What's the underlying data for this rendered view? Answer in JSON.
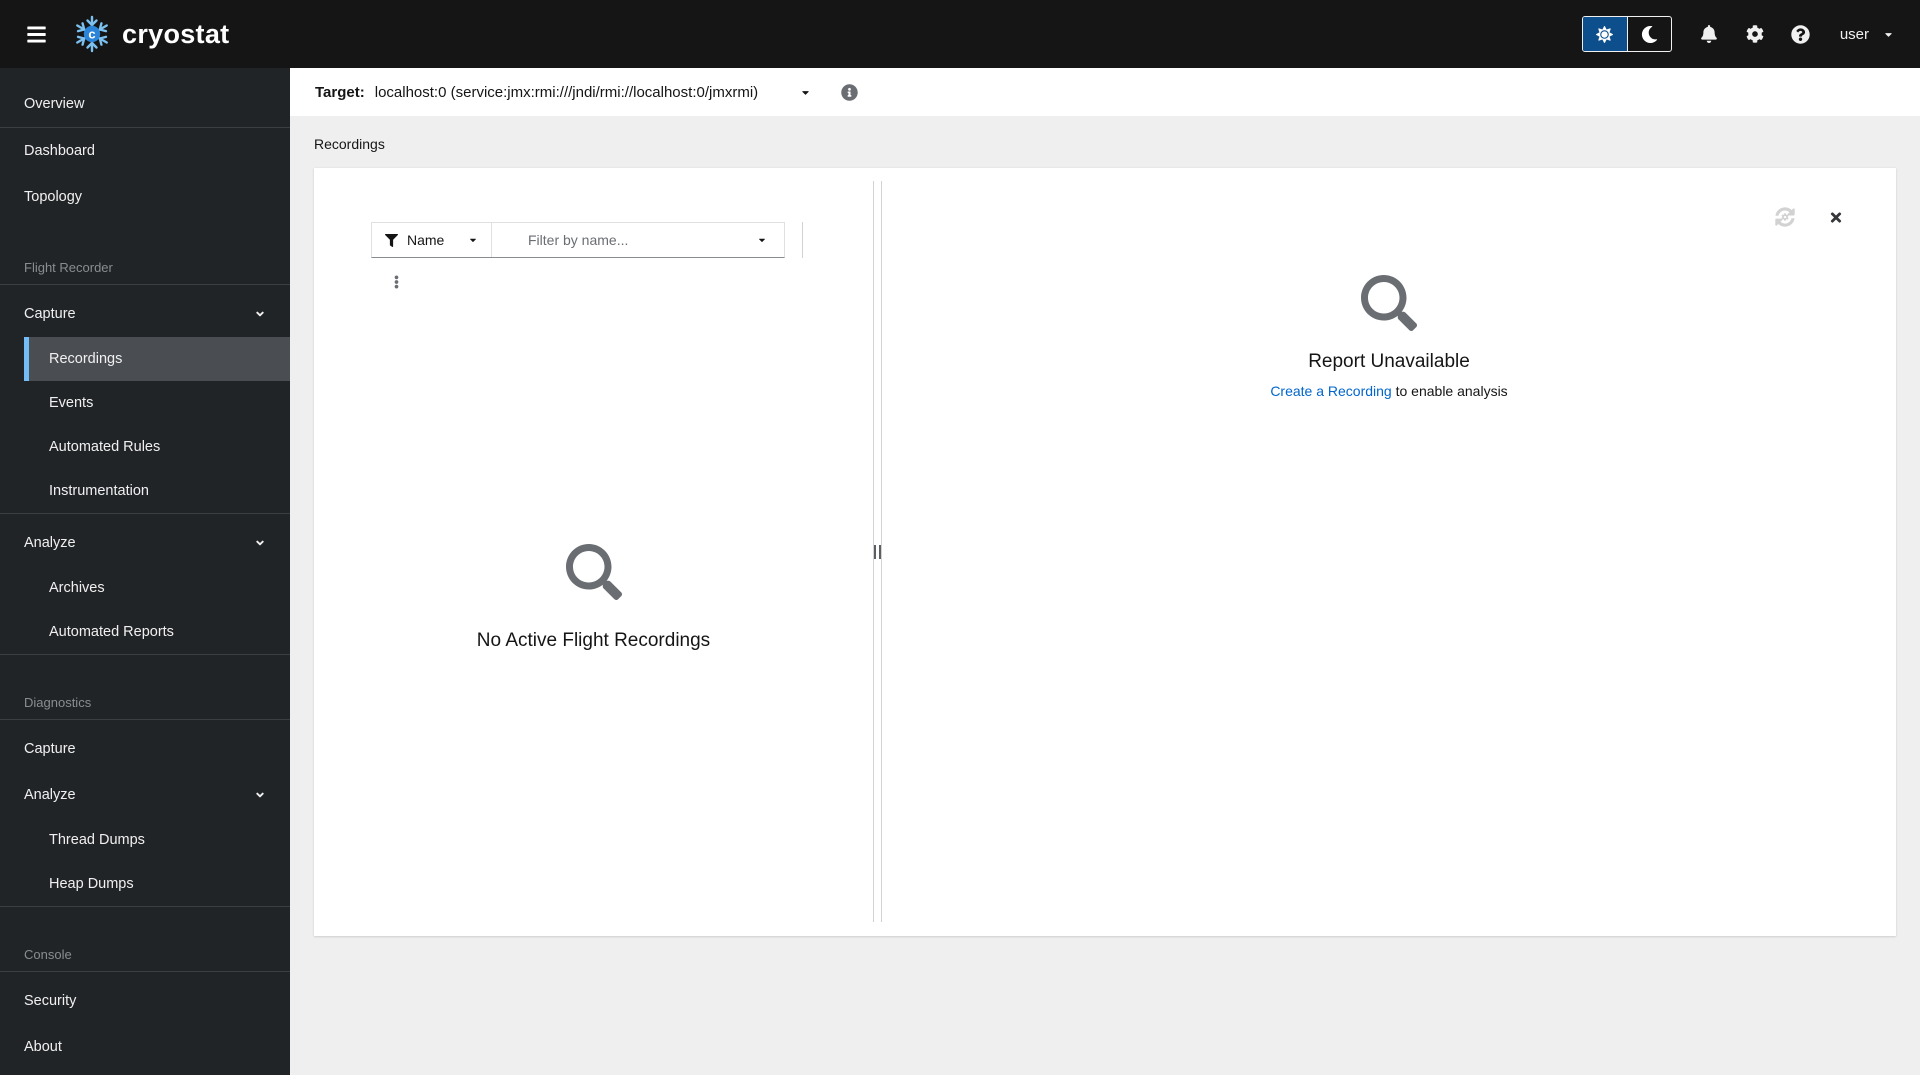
{
  "header": {
    "brand": "cryostat",
    "user": "user"
  },
  "sidebar": {
    "overview": "Overview",
    "dashboard": "Dashboard",
    "topology": "Topology",
    "flight_recorder": "Flight Recorder",
    "capture": "Capture",
    "recordings": "Recordings",
    "events": "Events",
    "automated_rules": "Automated Rules",
    "instrumentation": "Instrumentation",
    "analyze": "Analyze",
    "archives": "Archives",
    "automated_reports": "Automated Reports",
    "diagnostics": "Diagnostics",
    "capture_diagnostics": "Capture",
    "analyze_diagnostics": "Analyze",
    "thread_dumps": "Thread Dumps",
    "heap_dumps": "Heap Dumps",
    "console": "Console",
    "security": "Security",
    "about": "About"
  },
  "target_bar": {
    "label": "Target:",
    "value": "localhost:0 (service:jmx:rmi:///jndi/rmi://localhost:0/jmxrmi)"
  },
  "breadcrumb": {
    "current": "Recordings"
  },
  "toolbar": {
    "filter_category": "Name",
    "filter_placeholder": "Filter by name..."
  },
  "recordings_panel": {
    "empty_title": "No Active Flight Recordings"
  },
  "report_panel": {
    "title": "Report Unavailable",
    "link": "Create a Recording",
    "suffix": "to enable analysis"
  },
  "icons": {
    "hamburger": "menu bars",
    "snowflake_logo": "cryostat snowflake with letter c",
    "sun": "light theme",
    "moon": "dark theme",
    "bell": "notifications",
    "cog": "settings",
    "question_circle": "help",
    "caret_down": "dropdown caret",
    "chevron_down": "expanded nav group",
    "info_circle": "target details",
    "filter_funnel": "filter",
    "kebab": "actions menu",
    "search": "empty state magnifier",
    "refresh_gear": "recalculate report (disabled)",
    "close_x": "close panel"
  },
  "colors": {
    "masthead_bg": "#151515",
    "sidebar_bg": "#212427",
    "nav_current_bg": "#4a4d52",
    "nav_current_indicator": "#73bcf7",
    "theme_selected_bg": "#0d4e8c",
    "content_bg": "#efefef",
    "link": "#0066cc",
    "muted_icon": "#6a6e73",
    "snowflake_blue": "#7cc1ef",
    "snowflake_center": "#2b84d8"
  }
}
